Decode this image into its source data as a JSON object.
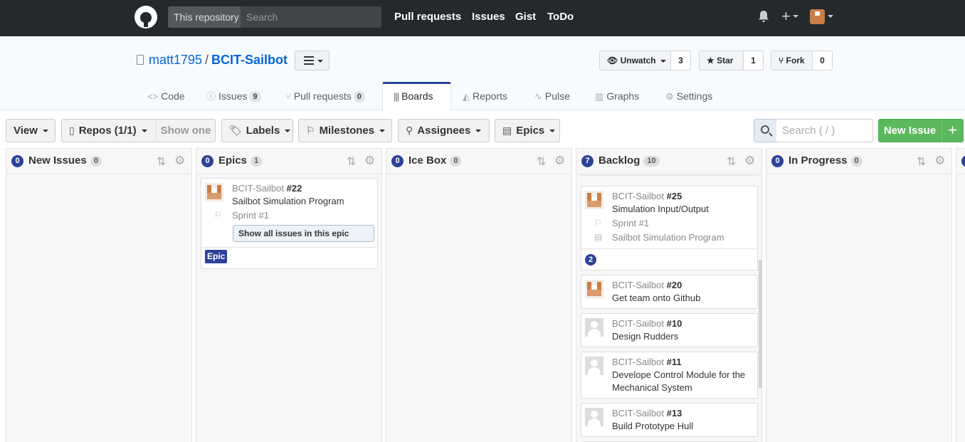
{
  "header": {
    "scope_label": "This repository",
    "search_placeholder": "Search",
    "nav": [
      "Pull requests",
      "Issues",
      "Gist",
      "ToDo"
    ]
  },
  "repo": {
    "owner": "matt1795",
    "slash": "/",
    "name": "BCIT-Sailbot",
    "unwatch_label": "Unwatch",
    "unwatch_count": "3",
    "star_label": "Star",
    "star_count": "1",
    "fork_label": "Fork",
    "fork_count": "0"
  },
  "reponav": {
    "code": "Code",
    "issues": "Issues",
    "issues_count": "9",
    "pulls": "Pull requests",
    "pulls_count": "0",
    "boards": "Boards",
    "reports": "Reports",
    "pulse": "Pulse",
    "graphs": "Graphs",
    "settings": "Settings"
  },
  "toolbar": {
    "view": "View",
    "repos": "Repos (1/1)",
    "show_one": "Show one",
    "labels": "Labels",
    "milestones": "Milestones",
    "assignees": "Assignees",
    "epics": "Epics",
    "search_placeholder": "Search ( / )",
    "new_issue": "New Issue",
    "plus": "+"
  },
  "columns": [
    {
      "badge": "0",
      "title": "New Issues",
      "count": "0"
    },
    {
      "badge": "0",
      "title": "Epics",
      "count": "1"
    },
    {
      "badge": "0",
      "title": "Ice Box",
      "count": "0"
    },
    {
      "badge": "7",
      "title": "Backlog",
      "count": "10"
    },
    {
      "badge": "0",
      "title": "In Progress",
      "count": "0"
    }
  ],
  "epic_card": {
    "repo": "BCIT-Sailbot",
    "number": "#22",
    "title": "Sailbot Simulation Program",
    "milestone": "Sprint #1",
    "show_all": "Show all issues in this epic",
    "label": "Epic"
  },
  "backlog_cards": [
    {
      "repo": "BCIT-Sailbot",
      "number": "#25",
      "title": "Simulation Input/Output",
      "milestone": "Sprint #1",
      "epic": "Sailbot Simulation Program",
      "sub_badge": "2"
    },
    {
      "repo": "BCIT-Sailbot",
      "number": "#20",
      "title": "Get team onto Github"
    },
    {
      "repo": "BCIT-Sailbot",
      "number": "#10",
      "title": "Design Rudders"
    },
    {
      "repo": "BCIT-Sailbot",
      "number": "#11",
      "title": "Develope Control Module for the Mechanical System"
    },
    {
      "repo": "BCIT-Sailbot",
      "number": "#13",
      "title": "Build Prototype Hull"
    }
  ],
  "icons": {
    "sort": "⇅",
    "gear": "⚙",
    "bell": "🔔",
    "plus": "+"
  }
}
